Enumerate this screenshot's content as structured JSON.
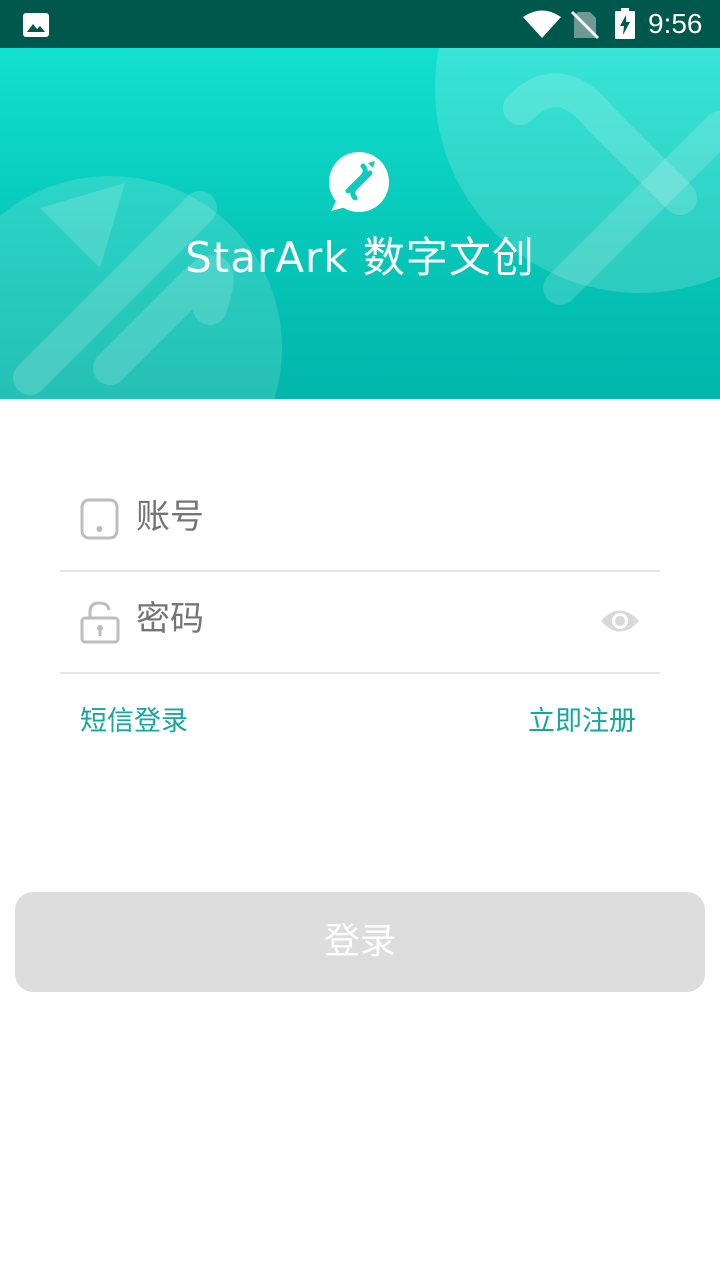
{
  "status_bar": {
    "time": "9:56",
    "icons": [
      "gallery-icon",
      "wifi-icon",
      "no-sim-icon",
      "battery-charging-icon"
    ]
  },
  "banner": {
    "brand_name": "StarArk 数字文创",
    "logo_icon": "brand-logo-icon",
    "gradient_colors": [
      "#12e0cf",
      "#02b6aa"
    ]
  },
  "form": {
    "account": {
      "placeholder": "账号",
      "icon": "phone-icon"
    },
    "password": {
      "placeholder": "密码",
      "icon": "lock-icon",
      "toggle_icon": "eye-icon"
    }
  },
  "links": {
    "sms_login": "短信登录",
    "register": "立即注册"
  },
  "login_button": {
    "label": "登录"
  },
  "colors": {
    "status_bar": "#00574b",
    "accent": "#13a89b",
    "button_disabled": "#dddddd",
    "placeholder": "#b8b8b8"
  }
}
